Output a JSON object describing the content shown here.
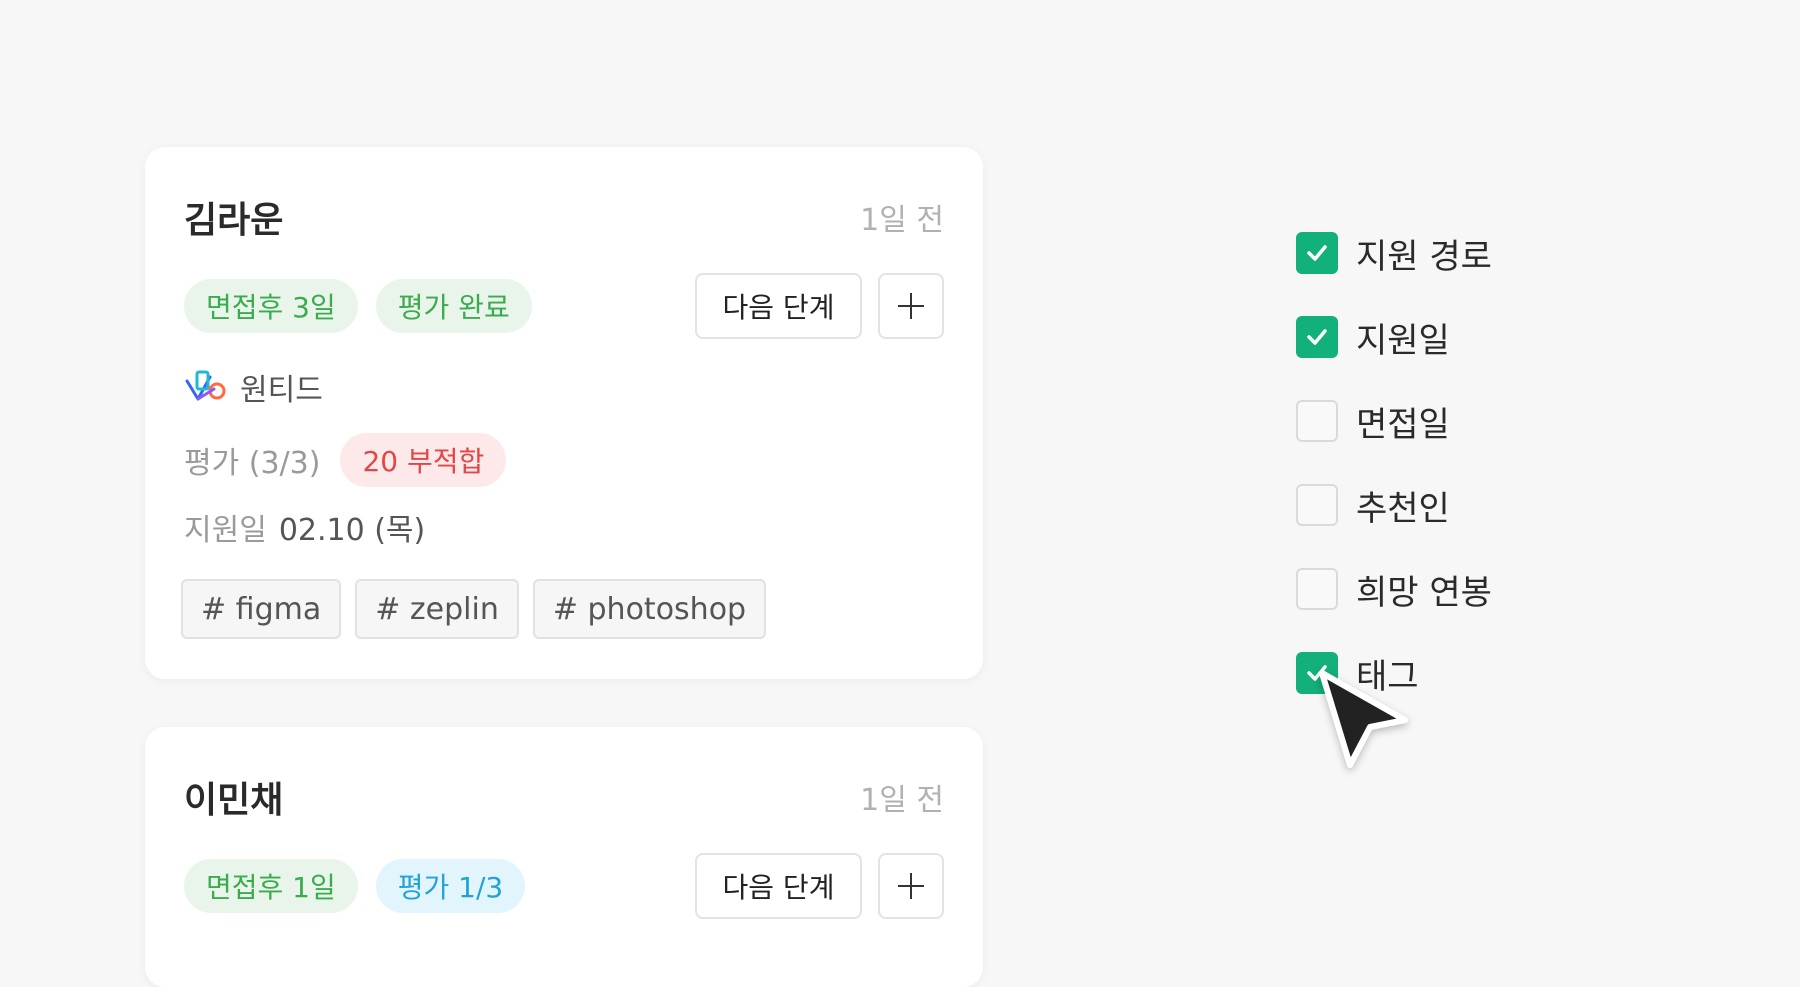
{
  "cards": [
    {
      "name": "김라운",
      "time": "1일 전",
      "pills": [
        "면접후 3일",
        "평가 완료"
      ],
      "next_button": "다음 단계",
      "source": "원티드",
      "evaluation_label": "평가 (3/3)",
      "evaluation_badge": "20 부적합",
      "applied_label": "지원일",
      "applied_date": "02.10 (목)",
      "tags": [
        "# figma",
        "# zeplin",
        "# photoshop"
      ]
    },
    {
      "name": "이민채",
      "time": "1일 전",
      "pills": [
        "면접후 1일",
        "평가 1/3"
      ],
      "next_button": "다음 단계"
    }
  ],
  "options": [
    {
      "label": "지원 경로",
      "checked": true
    },
    {
      "label": "지원일",
      "checked": true
    },
    {
      "label": "면접일",
      "checked": false
    },
    {
      "label": "추천인",
      "checked": false
    },
    {
      "label": "희망 연봉",
      "checked": false
    },
    {
      "label": "태그",
      "checked": true
    }
  ],
  "colors": {
    "check_on": "#12b07a",
    "pill_green_text": "#3bab4f",
    "pill_blue_text": "#22a2d6",
    "pill_red_text": "#e04848"
  },
  "icons": {
    "source_logo": "wanted-logo-icon",
    "check": "check-icon",
    "plus": "plus-icon",
    "cursor": "mouse-cursor-icon"
  }
}
